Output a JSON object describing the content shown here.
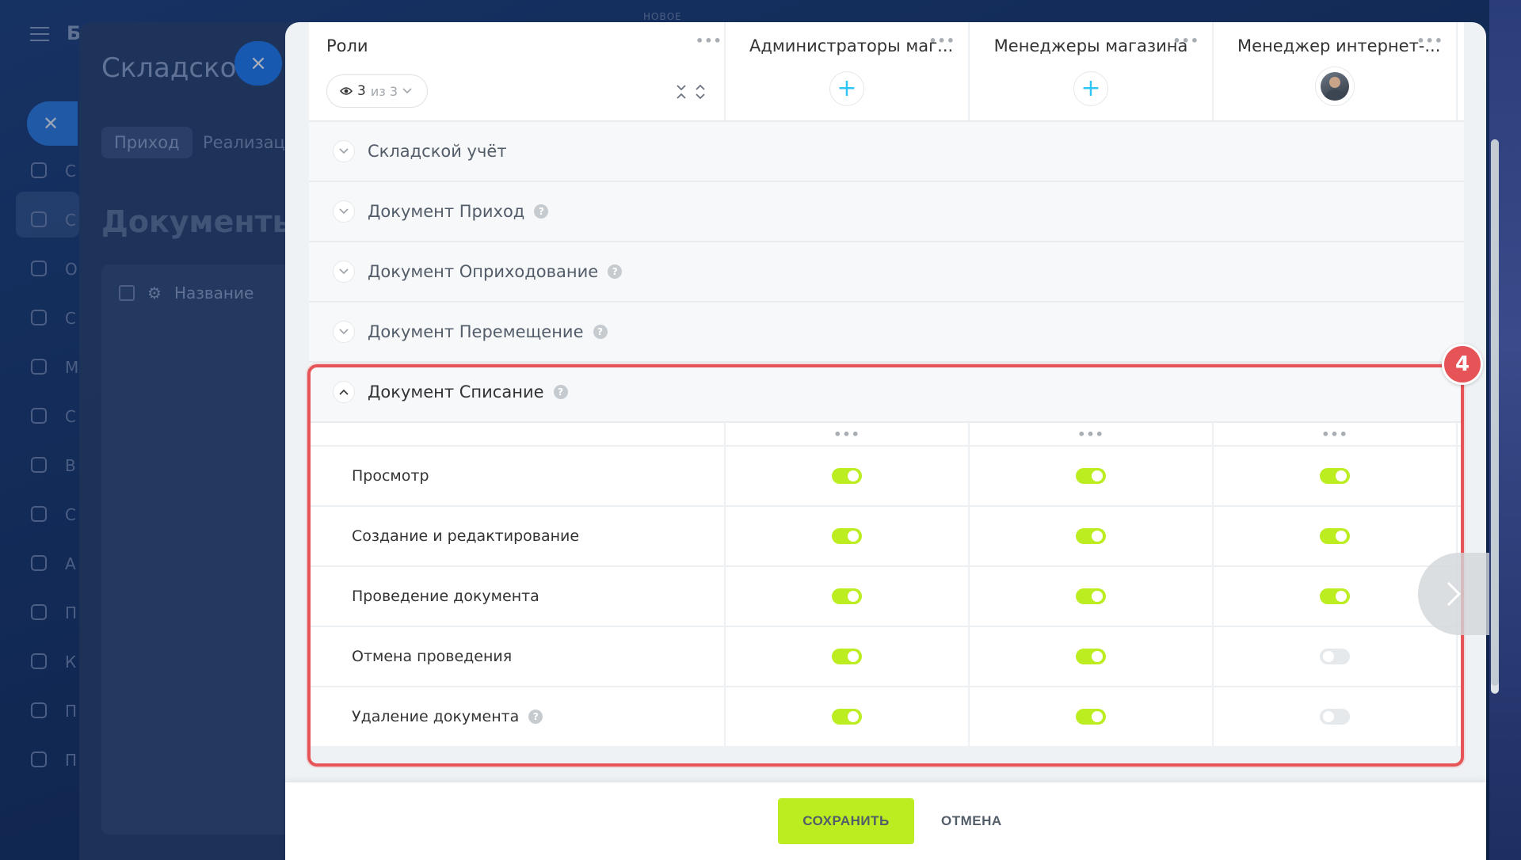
{
  "background": {
    "brand_letter": "Б",
    "new_label": "НОВОЕ",
    "panel_title": "Складской",
    "close_label": "×",
    "tabs": [
      {
        "label": "Приход"
      },
      {
        "label": "Реализаци"
      }
    ],
    "heading": "Документы п",
    "table_header": "Название",
    "rail_letters": [
      "С",
      "С",
      "О",
      "С",
      "М",
      "С",
      "В",
      "С",
      "А",
      "П",
      "К",
      "П",
      "П"
    ]
  },
  "header": {
    "roles_title": "Роли",
    "filter": {
      "count": "3",
      "of_label": "из 3"
    },
    "columns": [
      {
        "title": "Администраторы маг...",
        "action": "plus"
      },
      {
        "title": "Менеджеры магазина",
        "action": "plus"
      },
      {
        "title": "Менеджер интернет-...",
        "action": "avatar"
      }
    ]
  },
  "sections": [
    {
      "title": "Складской учёт",
      "help": false
    },
    {
      "title": "Документ Приход",
      "help": true
    },
    {
      "title": "Документ Оприходование",
      "help": true
    },
    {
      "title": "Документ Перемещение",
      "help": true
    }
  ],
  "open_section": {
    "title": "Документ Списание",
    "rows": [
      {
        "label": "Просмотр",
        "help": false,
        "values": [
          true,
          true,
          true
        ]
      },
      {
        "label": "Создание и редактирование",
        "help": false,
        "values": [
          true,
          true,
          true
        ]
      },
      {
        "label": "Проведение документа",
        "help": false,
        "values": [
          true,
          true,
          true
        ]
      },
      {
        "label": "Отмена проведения",
        "help": false,
        "values": [
          true,
          true,
          false
        ]
      },
      {
        "label": "Удаление документа",
        "help": true,
        "values": [
          true,
          true,
          false
        ]
      }
    ]
  },
  "annotation": {
    "badge": "4",
    "color": "#e75458"
  },
  "footer": {
    "save_label": "СОХРАНИТЬ",
    "cancel_label": "ОТМЕНА"
  },
  "colors": {
    "accent_green": "#bbed21",
    "plus_blue": "#2fc6f6",
    "toggle_off": "#e6e9ec"
  }
}
